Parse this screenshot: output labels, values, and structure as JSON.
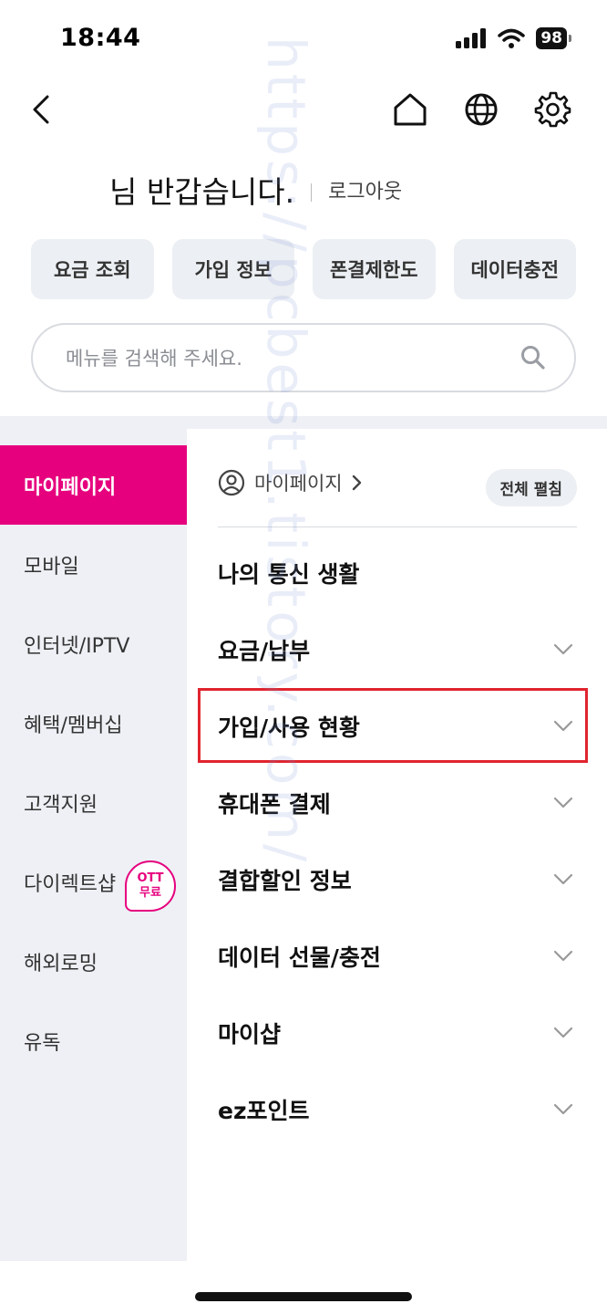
{
  "status": {
    "time": "18:44",
    "battery": "98"
  },
  "header": {
    "back_icon": "chevron-left-icon",
    "home_icon": "home-icon",
    "globe_icon": "globe-icon",
    "settings_icon": "gear-icon"
  },
  "greeting": {
    "text": "님 반갑습니다.",
    "logout": "로그아웃"
  },
  "quick_buttons": [
    "요금 조회",
    "가입 정보",
    "폰결제한도",
    "데이터충전"
  ],
  "search": {
    "placeholder": "메뉴를 검색해 주세요."
  },
  "sidebar": {
    "items": [
      {
        "label": "마이페이지",
        "active": true
      },
      {
        "label": "모바일"
      },
      {
        "label": "인터넷/IPTV"
      },
      {
        "label": "혜택/멤버십"
      },
      {
        "label": "고객지원"
      },
      {
        "label": "다이렉트샵"
      },
      {
        "label": "해외로밍"
      },
      {
        "label": "유독"
      }
    ],
    "badge_line1": "OTT",
    "badge_line2": "무료"
  },
  "content": {
    "breadcrumb": "마이페이지",
    "expand_all": "전체 펼침",
    "menu": [
      {
        "label": "나의 통신 생활",
        "has_chevron": false
      },
      {
        "label": "요금/납부",
        "has_chevron": true
      },
      {
        "label": "가입/사용 현황",
        "has_chevron": true,
        "highlighted": true
      },
      {
        "label": "휴대폰 결제",
        "has_chevron": true
      },
      {
        "label": "결합할인 정보",
        "has_chevron": true
      },
      {
        "label": "데이터 선물/충전",
        "has_chevron": true
      },
      {
        "label": "마이샵",
        "has_chevron": true
      },
      {
        "label": "ez포인트",
        "has_chevron": true
      }
    ]
  },
  "watermark": "https://pcbest1.tistory.com/",
  "colors": {
    "accent": "#e6007e",
    "highlight": "#e0242f",
    "panel": "#eef0f5"
  }
}
